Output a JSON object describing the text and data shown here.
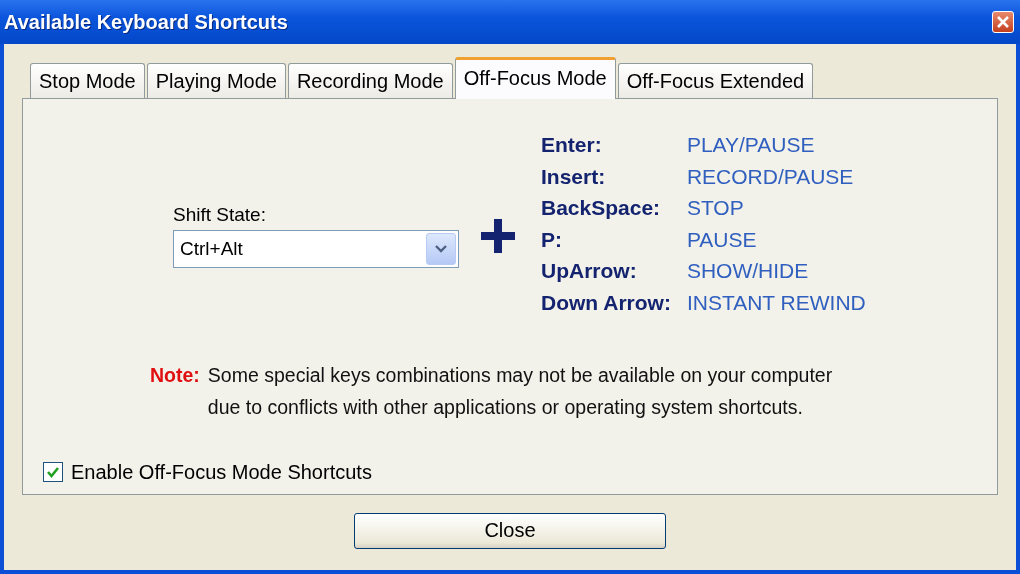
{
  "window": {
    "title": "Available Keyboard Shortcuts"
  },
  "tabs": [
    {
      "label": "Stop Mode",
      "selected": false
    },
    {
      "label": "Playing Mode",
      "selected": false
    },
    {
      "label": "Recording Mode",
      "selected": false
    },
    {
      "label": "Off-Focus Mode",
      "selected": true
    },
    {
      "label": "Off-Focus Extended",
      "selected": false
    }
  ],
  "shift_state": {
    "label": "Shift State:",
    "value": "Ctrl+Alt"
  },
  "shortcuts": [
    {
      "key": "Enter:",
      "action": "PLAY/PAUSE"
    },
    {
      "key": "Insert:",
      "action": "RECORD/PAUSE"
    },
    {
      "key": "BackSpace:",
      "action": "STOP"
    },
    {
      "key": "P:",
      "action": "PAUSE"
    },
    {
      "key": "UpArrow:",
      "action": "SHOW/HIDE"
    },
    {
      "key": "Down Arrow:",
      "action": "INSTANT REWIND"
    }
  ],
  "note": {
    "label": "Note:",
    "text": "Some special keys combinations may not be available on your computer due to conflicts with other applications or operating system shortcuts."
  },
  "enable_checkbox": {
    "label": "Enable Off-Focus Mode Shortcuts",
    "checked": true
  },
  "buttons": [
    {
      "label": "Close"
    }
  ]
}
